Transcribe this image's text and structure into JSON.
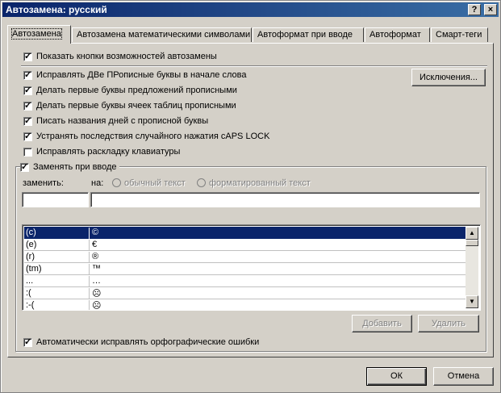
{
  "window": {
    "title": "Автозамена: русский",
    "help_glyph": "?",
    "close_glyph": "×"
  },
  "tabs": [
    {
      "label": "Автозамена",
      "active": true
    },
    {
      "label": "Автозамена математическими символами"
    },
    {
      "label": "Автоформат при вводе"
    },
    {
      "label": "Автоформат"
    },
    {
      "label": "Смарт-теги"
    }
  ],
  "options": {
    "show_buttons": {
      "label": "Показать кнопки возможностей автозамены",
      "checked": true
    },
    "fix_two_caps": {
      "label": "Исправлять ДВе ПРописные буквы в начале слова",
      "checked": true
    },
    "cap_sentence": {
      "label": "Делать первые буквы предложений прописными",
      "checked": true
    },
    "cap_table": {
      "label": "Делать первые буквы ячеек таблиц прописными",
      "checked": true
    },
    "cap_days": {
      "label": "Писать названия дней с прописной буквы",
      "checked": true
    },
    "caps_lock": {
      "label": "Устранять последствия случайного нажатия cAPS LOCK",
      "checked": true
    },
    "keyboard_layout": {
      "label": "Исправлять раскладку клавиатуры",
      "checked": false
    },
    "replace_typing": {
      "label": "Заменять при вводе",
      "checked": true
    },
    "auto_spelling": {
      "label": "Автоматически исправлять орфографические ошибки",
      "checked": true
    }
  },
  "exceptions_button": "Исключения...",
  "replace_label": "заменить:",
  "with_label": "на:",
  "radio_plain": "обычный текст",
  "radio_formatted": "форматированный текст",
  "replace_value": "",
  "with_value": "",
  "entries": [
    {
      "from": "(c)",
      "to": "©"
    },
    {
      "from": "(e)",
      "to": "€"
    },
    {
      "from": "(r)",
      "to": "®"
    },
    {
      "from": "(tm)",
      "to": "™"
    },
    {
      "from": "...",
      "to": "…"
    },
    {
      "from": ":(",
      "to": "☹"
    },
    {
      "from": ":-(",
      "to": "☹"
    }
  ],
  "add_button": "Добавить",
  "delete_button": "Удалить",
  "ok_button": "ОК",
  "cancel_button": "Отмена",
  "scroll_up": "▲",
  "scroll_down": "▼"
}
